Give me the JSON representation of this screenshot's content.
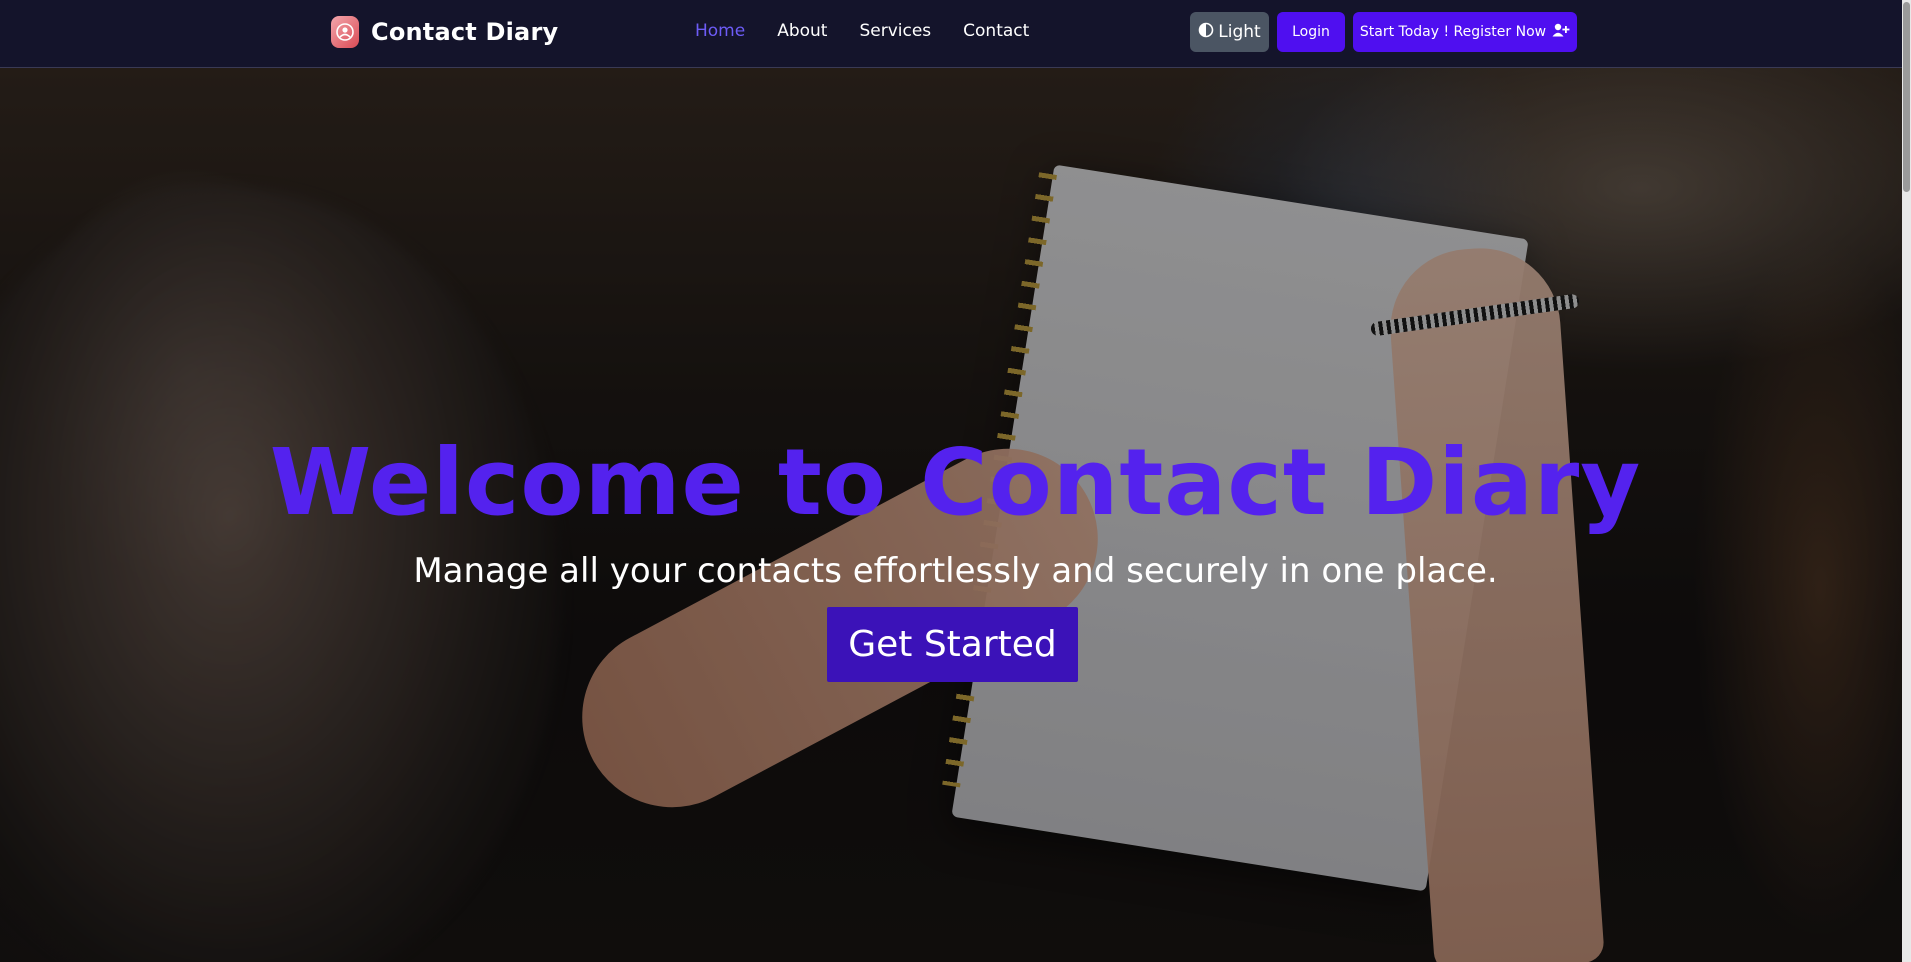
{
  "navbar": {
    "brand": "Contact Diary",
    "links": [
      {
        "label": "Home",
        "active": true
      },
      {
        "label": "About",
        "active": false
      },
      {
        "label": "Services",
        "active": false
      },
      {
        "label": "Contact",
        "active": false
      }
    ],
    "theme_toggle_label": "Light",
    "login_label": "Login",
    "register_label": "Start Today ! Register Now"
  },
  "hero": {
    "title": "Welcome to Contact Diary",
    "subtitle": "Manage all your contacts effortlessly and securely in one place.",
    "cta_label": "Get Started"
  },
  "colors": {
    "navbar_bg": "#14142b",
    "accent": "#4f0ff0",
    "title": "#5422ee",
    "active_link": "#6d5cf6",
    "cta_bg": "#3b12b8"
  },
  "icons": {
    "brand": "contact-diary-logo-icon",
    "theme": "half-circle-contrast-icon",
    "register": "user-plus-icon"
  }
}
